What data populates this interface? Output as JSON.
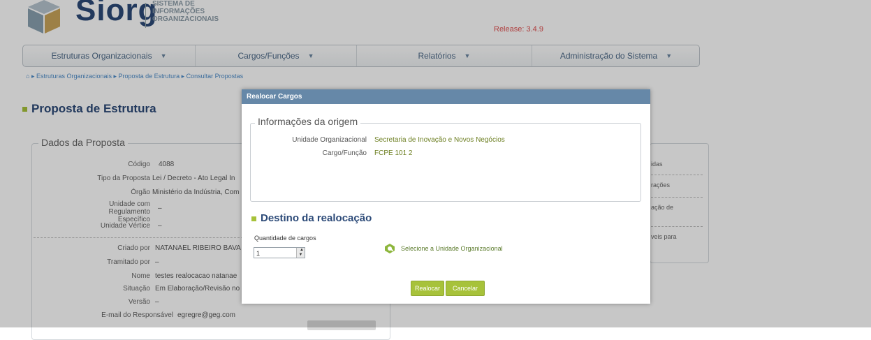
{
  "header": {
    "logo_text": "Siorg",
    "subtitle_lines": [
      "SISTEMA DE",
      "INFORMAÇÕES",
      "ORGANIZACIONAIS"
    ],
    "release": "Release: 3.4.9"
  },
  "menu": {
    "items": [
      {
        "label": "Estruturas Organizacionais"
      },
      {
        "label": "Cargos/Funções"
      },
      {
        "label": "Relatórios"
      },
      {
        "label": "Administração do Sistema"
      }
    ]
  },
  "breadcrumb": "Estruturas Organizacionais ▸ Proposta de Estrutura ▸ Consultar Propostas",
  "page_title": "Proposta de Estrutura",
  "dados": {
    "legend": "Dados da Proposta",
    "rows": [
      {
        "label": "Código",
        "value": "4088"
      },
      {
        "label": "Tipo da Proposta",
        "value": "Lei / Decreto - Ato Legal In"
      },
      {
        "label": "Órgão",
        "value": "Ministério da Indústria, Com"
      },
      {
        "label": "Unidade com Regulamento Específico",
        "value": "–"
      },
      {
        "label": "Unidade Vértice",
        "value": "–"
      },
      {
        "label": "Criado por",
        "value": "NATANAEL RIBEIRO BAVA"
      },
      {
        "label": "Tramitado por",
        "value": "–"
      },
      {
        "label": "Nome",
        "value": "testes realocacao natanae"
      },
      {
        "label": "Situação",
        "value": "Em Elaboração/Revisão no"
      },
      {
        "label": "Versão",
        "value": "–"
      },
      {
        "label": "E-mail do Responsável",
        "value": "egregre@geg.com"
      }
    ]
  },
  "right_panel": {
    "items": [
      "idas",
      "rações",
      "ação de",
      "veis para"
    ]
  },
  "modal": {
    "title": "Realocar Cargos",
    "origem_legend": "Informações da origem",
    "unidade_label": "Unidade Organizacional",
    "unidade_value": "Secretaria de Inovação e Novos Negócios",
    "cargo_label": "Cargo/Função",
    "cargo_value": "FCPE 101 2",
    "destino_title": "Destino da realocação",
    "quantidade_label": "Quantidade de cargos",
    "quantidade_value": "1",
    "select_unit_label": "Selecione a Unidade Organizacional",
    "realocar_label": "Realocar",
    "cancelar_label": "Cancelar"
  },
  "colors": {
    "accent_green": "#a7c23a",
    "title_blue": "#2c4a78",
    "modal_header": "#6688a8",
    "release_red": "#e05050"
  }
}
